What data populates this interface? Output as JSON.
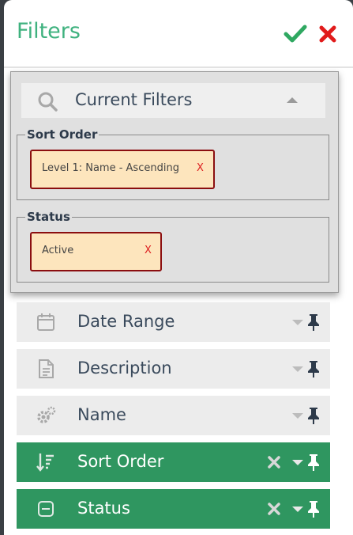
{
  "header": {
    "title": "Filters",
    "apply_icon": "check-icon",
    "close_icon": "close-icon",
    "title_color": "#3fb27f",
    "apply_color": "#2fa861",
    "close_color": "#e11b1b"
  },
  "current_filters": {
    "label": "Current Filters",
    "groups": [
      {
        "legend": "Sort Order",
        "chip_text": "Level 1: Name - Ascending",
        "chip_remove": "X"
      },
      {
        "legend": "Status",
        "chip_text": "Active",
        "chip_remove": "X"
      }
    ]
  },
  "filter_rows": [
    {
      "label": "Date Range",
      "icon": "calendar-icon",
      "active": false
    },
    {
      "label": "Description",
      "icon": "document-icon",
      "active": false
    },
    {
      "label": "Name",
      "icon": "gears-icon",
      "active": false
    },
    {
      "label": "Sort Order",
      "icon": "sort-icon",
      "active": true
    },
    {
      "label": "Status",
      "icon": "minus-square-icon",
      "active": true
    }
  ],
  "colors": {
    "active_row": "#2f9660",
    "chip_bg": "#fde5bd",
    "chip_border": "#8b0e10"
  }
}
